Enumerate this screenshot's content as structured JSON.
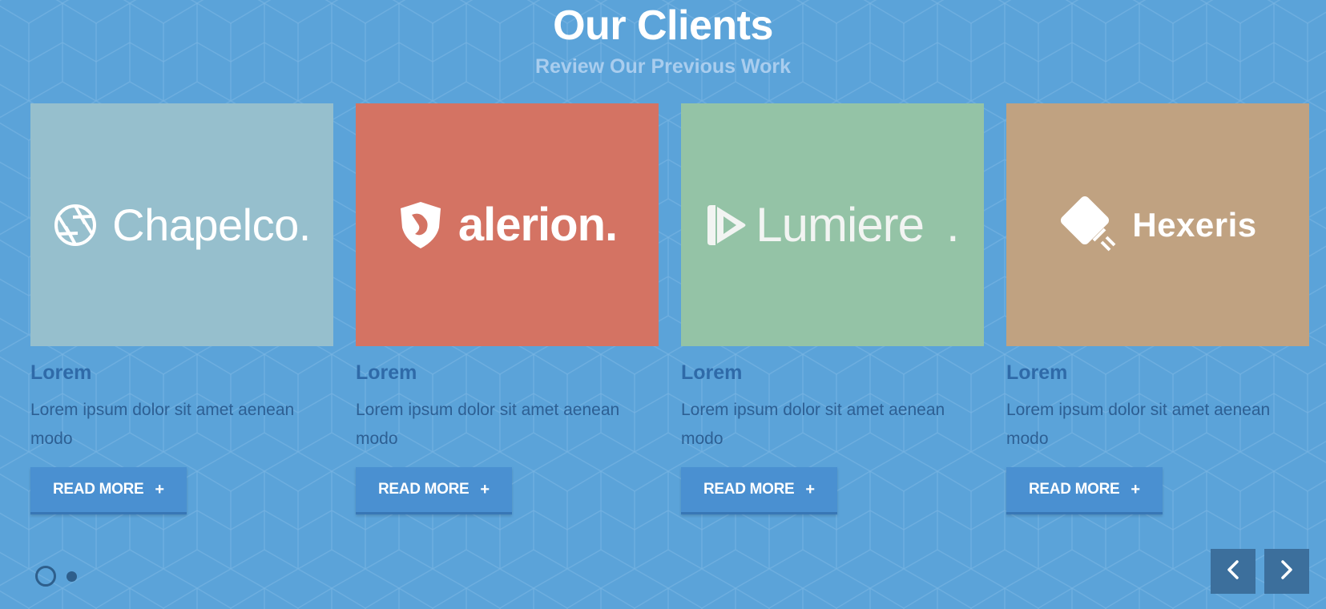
{
  "section": {
    "title": "Our Clients",
    "subtitle": "Review Our Previous Work"
  },
  "cards": [
    {
      "logo_text": "Chapelco.",
      "logo_icon": "aperture-icon",
      "bg_color": "#96bfcd",
      "title": "Lorem",
      "text": "Lorem ipsum dolor sit amet aenean modo",
      "button_label": "READ MORE",
      "button_icon": "+"
    },
    {
      "logo_text": "alerion.",
      "logo_icon": "shield-icon",
      "bg_color": "#d47363",
      "title": "Lorem",
      "text": "Lorem ipsum dolor sit amet aenean modo",
      "button_label": "READ MORE",
      "button_icon": "+"
    },
    {
      "logo_text": "Lumiere",
      "logo_suffix": ".",
      "logo_icon": "play-icon",
      "bg_color": "#94c3a6",
      "title": "Lorem",
      "text": "Lorem ipsum dolor sit amet aenean modo",
      "button_label": "READ MORE",
      "button_icon": "+"
    },
    {
      "logo_text": "Hexeris",
      "logo_icon": "plug-icon",
      "bg_color": "#c0a281",
      "title": "Lorem",
      "text": "Lorem ipsum dolor sit amet aenean modo",
      "button_label": "READ MORE",
      "button_icon": "+"
    }
  ],
  "pagination": {
    "pages": 2,
    "active": 1
  },
  "nav": {
    "prev_icon": "chevron-left-icon",
    "next_icon": "chevron-right-icon"
  },
  "colors": {
    "background": "#5ba3d9",
    "button": "#4a90d1",
    "nav_button": "#3c6f9c",
    "title_text": "#2f6aa8",
    "body_text": "#2d5f93"
  }
}
